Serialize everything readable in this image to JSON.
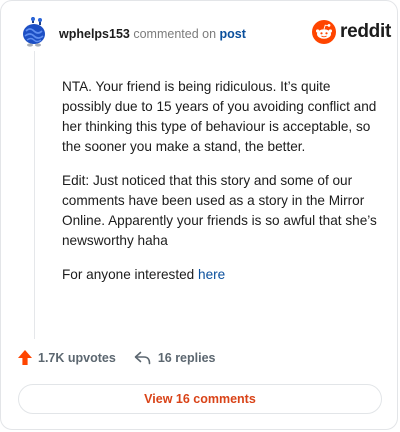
{
  "header": {
    "username": "wphelps153",
    "action_text": "commented on",
    "post_link": "post",
    "brand": "reddit"
  },
  "comment": {
    "paragraphs": [
      "NTA. Your friend is being ridiculous. It’s quite possibly due to 15 years of you avoiding conflict and her thinking this type of behaviour is acceptable, so the sooner you make a stand, the better.",
      "Edit: Just noticed that this story and some of our comments have been used as a story in the Mirror Online. Apparently your friends is so awful that she’s newsworthy haha"
    ],
    "last_line_prefix": "For anyone interested",
    "last_line_link": "here"
  },
  "footer": {
    "upvotes_label": "1.7K upvotes",
    "replies_label": "16 replies",
    "upvote_icon": "arrow-up-icon",
    "reply_icon": "reply-arrow-icon"
  },
  "view_comments_label": "View 16 comments",
  "colors": {
    "upvote": "#ff4500",
    "link": "#0a4f9c",
    "view_button_text": "#d94318",
    "muted": "#7c7c7c"
  }
}
